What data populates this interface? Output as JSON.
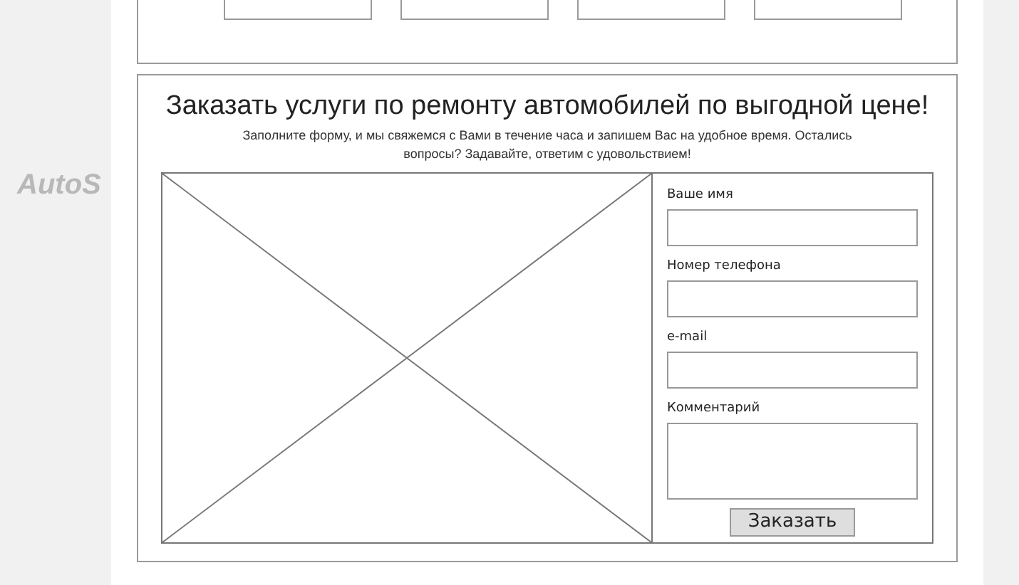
{
  "background_logo": "AutoS",
  "order_form": {
    "title": "Заказать услуги по ремонту автомобилей по выгодной цене!",
    "subtitle": "Заполните форму, и мы свяжемся с Вами в течение часа и запишем Вас на удобное время. Остались вопросы? Задавайте, ответим с удовольствием!",
    "fields": [
      {
        "label": "Ваше имя",
        "kind": "input"
      },
      {
        "label": "Номер телефона",
        "kind": "input"
      },
      {
        "label": "e-mail",
        "kind": "input"
      },
      {
        "label": "Комментарий",
        "kind": "textarea"
      }
    ],
    "submit": "Заказать"
  }
}
